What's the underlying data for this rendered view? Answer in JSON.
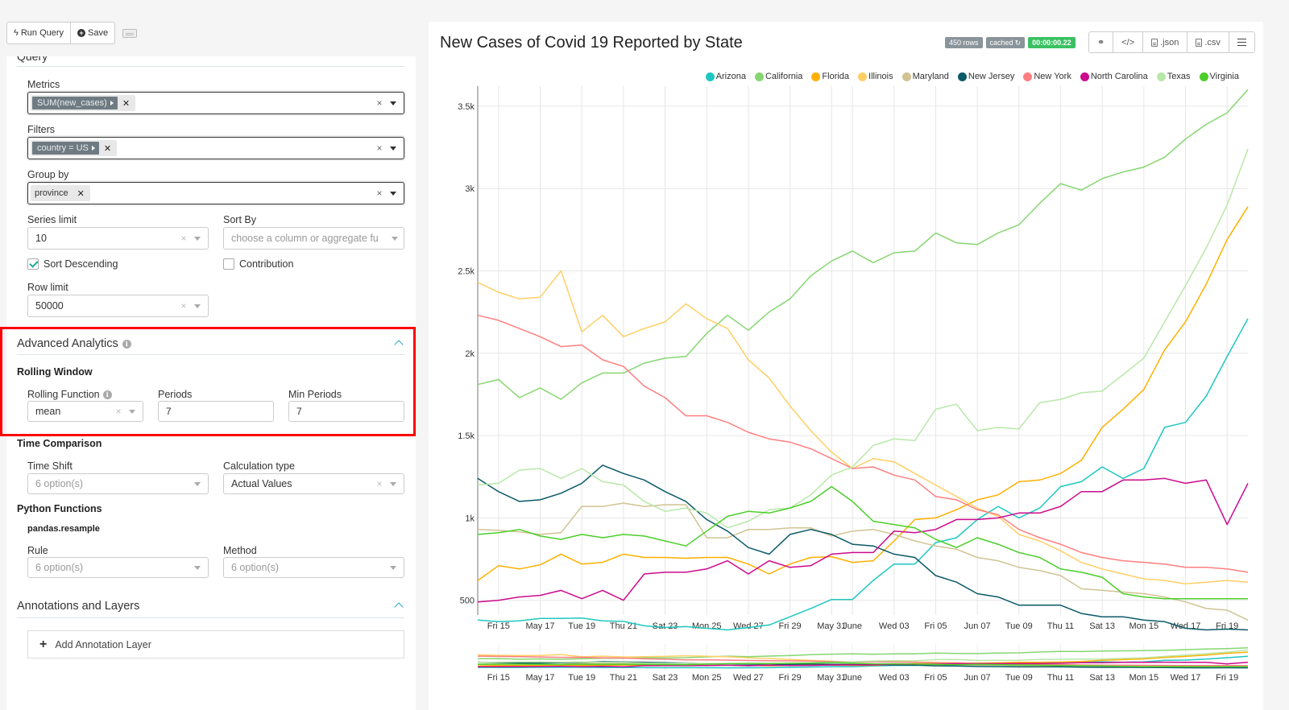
{
  "toolbar": {
    "run_query_label": "Run Query",
    "save_label": "Save"
  },
  "query_section": {
    "title": "Query",
    "metrics": {
      "label": "Metrics",
      "tags": [
        "SUM(new_cases)"
      ]
    },
    "filters": {
      "label": "Filters",
      "tags": [
        "country = US"
      ]
    },
    "group_by": {
      "label": "Group by",
      "tags": [
        "province"
      ]
    },
    "series_limit": {
      "label": "Series limit",
      "value": "10"
    },
    "sort_by": {
      "label": "Sort By",
      "placeholder": "choose a column or aggregate fu"
    },
    "sort_descending": {
      "label": "Sort Descending",
      "checked": true
    },
    "contribution": {
      "label": "Contribution",
      "checked": false
    },
    "row_limit": {
      "label": "Row limit",
      "value": "50000"
    }
  },
  "advanced_analytics": {
    "title": "Advanced Analytics",
    "rolling_window": {
      "heading": "Rolling Window",
      "rolling_function": {
        "label": "Rolling Function",
        "value": "mean"
      },
      "periods": {
        "label": "Periods",
        "value": "7"
      },
      "min_periods": {
        "label": "Min Periods",
        "value": "7"
      }
    },
    "time_comparison": {
      "heading": "Time Comparison",
      "time_shift": {
        "label": "Time Shift",
        "placeholder": "6 option(s)"
      },
      "calculation_type": {
        "label": "Calculation type",
        "value": "Actual Values"
      }
    },
    "python_functions": {
      "heading": "Python Functions",
      "subheading": "pandas.resample",
      "rule": {
        "label": "Rule",
        "placeholder": "6 option(s)"
      },
      "method": {
        "label": "Method",
        "placeholder": "6 option(s)"
      }
    }
  },
  "annotations": {
    "title": "Annotations and Layers",
    "add_label": "Add Annotation Layer"
  },
  "chart_header": {
    "title": "New Cases of Covid 19 Reported by State",
    "rows_badge": "450 rows",
    "cached_badge": "cached",
    "timer_badge": "00:00:00.22",
    "actions": {
      "json": ".json",
      "csv": ".csv"
    }
  },
  "colors": {
    "Arizona": "#1fc7c1",
    "California": "#86d671",
    "Florida": "#ffb000",
    "Illinois": "#ffcf66",
    "Maryland": "#d1c393",
    "New Jersey": "#0b5a68",
    "New York": "#ff7f80",
    "North Carolina": "#cc0a8c",
    "Texas": "#b8e8a8",
    "Virginia": "#4cce2a"
  },
  "chart_data": {
    "type": "line",
    "title": "New Cases of Covid 19 Reported by State",
    "xlabel": "",
    "ylabel": "",
    "ylim": [
      240,
      3600
    ],
    "yticks": [
      500,
      1000,
      1500,
      2000,
      2500,
      3000,
      3500
    ],
    "ytick_labels": [
      "500",
      "1k",
      "1.5k",
      "2k",
      "2.5k",
      "3k",
      "3.5k"
    ],
    "xtick_labels": [
      "Fri 15",
      "May 17",
      "Tue 19",
      "Thu 21",
      "Sat 23",
      "Mon 25",
      "Wed 27",
      "Fri 29",
      "May 31",
      "June",
      "Wed 03",
      "Fri 05",
      "Jun 07",
      "Tue 09",
      "Thu 11",
      "Sat 13",
      "Mon 15",
      "Wed 17",
      "Fri 19"
    ],
    "xtick_day_index": [
      1,
      3,
      5,
      7,
      9,
      11,
      13,
      15,
      17,
      18,
      20,
      22,
      24,
      26,
      28,
      30,
      32,
      34,
      36
    ],
    "x_start": "2020-05-14",
    "x_end": "2020-06-20",
    "grid": true,
    "legend": "top-right",
    "series": [
      {
        "name": "Arizona",
        "values": [
          380,
          370,
          375,
          390,
          390,
          392,
          375,
          372,
          345,
          335,
          340,
          330,
          320,
          335,
          350,
          400,
          450,
          505,
          505,
          620,
          720,
          720,
          850,
          880,
          990,
          1070,
          1000,
          1060,
          1190,
          1220,
          1310,
          1240,
          1300,
          1550,
          1580,
          1740,
          1980,
          2210
        ]
      },
      {
        "name": "California",
        "values": [
          1810,
          1840,
          1730,
          1790,
          1720,
          1820,
          1880,
          1880,
          1940,
          1970,
          1980,
          2120,
          2230,
          2140,
          2250,
          2330,
          2470,
          2560,
          2620,
          2550,
          2610,
          2620,
          2730,
          2670,
          2660,
          2730,
          2780,
          2910,
          3030,
          2990,
          3060,
          3100,
          3130,
          3190,
          3300,
          3390,
          3460,
          3600
        ]
      },
      {
        "name": "Florida",
        "values": [
          620,
          710,
          690,
          715,
          780,
          720,
          730,
          780,
          760,
          760,
          755,
          760,
          760,
          720,
          660,
          720,
          760,
          765,
          730,
          740,
          860,
          990,
          1000,
          1050,
          1110,
          1140,
          1220,
          1230,
          1270,
          1350,
          1550,
          1660,
          1780,
          2020,
          2190,
          2420,
          2690,
          2890
        ]
      },
      {
        "name": "Illinois",
        "values": [
          2430,
          2370,
          2330,
          2340,
          2500,
          2130,
          2230,
          2100,
          2150,
          2190,
          2300,
          2210,
          2150,
          1960,
          1850,
          1680,
          1530,
          1400,
          1300,
          1360,
          1340,
          1270,
          1200,
          1130,
          1060,
          1010,
          900,
          860,
          800,
          730,
          690,
          660,
          630,
          620,
          600,
          610,
          620,
          610
        ]
      },
      {
        "name": "Maryland",
        "values": [
          930,
          925,
          915,
          900,
          910,
          1070,
          1070,
          1090,
          1070,
          1080,
          1080,
          880,
          880,
          930,
          930,
          940,
          940,
          890,
          920,
          930,
          900,
          860,
          830,
          810,
          760,
          740,
          700,
          680,
          650,
          570,
          560,
          550,
          540,
          520,
          490,
          450,
          440,
          380
        ]
      },
      {
        "name": "New Jersey",
        "values": [
          1240,
          1160,
          1100,
          1110,
          1150,
          1210,
          1320,
          1270,
          1230,
          1160,
          1100,
          990,
          920,
          820,
          780,
          900,
          930,
          900,
          840,
          830,
          780,
          760,
          650,
          610,
          540,
          520,
          470,
          470,
          470,
          420,
          400,
          400,
          380,
          370,
          330,
          320,
          325,
          320
        ]
      },
      {
        "name": "New York",
        "values": [
          2230,
          2200,
          2150,
          2100,
          2040,
          2050,
          1960,
          1920,
          1800,
          1730,
          1620,
          1620,
          1580,
          1520,
          1480,
          1460,
          1420,
          1360,
          1300,
          1310,
          1260,
          1230,
          1130,
          1110,
          1050,
          1020,
          930,
          880,
          840,
          790,
          760,
          740,
          730,
          720,
          700,
          700,
          690,
          670
        ]
      },
      {
        "name": "North Carolina",
        "values": [
          490,
          500,
          520,
          530,
          560,
          510,
          560,
          500,
          660,
          670,
          670,
          690,
          740,
          660,
          740,
          700,
          710,
          780,
          790,
          790,
          920,
          910,
          930,
          990,
          990,
          1000,
          1030,
          1030,
          1070,
          1160,
          1160,
          1230,
          1230,
          1240,
          1210,
          1230,
          960,
          1210
        ]
      },
      {
        "name": "Texas",
        "values": [
          1200,
          1210,
          1290,
          1300,
          1240,
          1300,
          1220,
          1200,
          1100,
          1040,
          1060,
          1030,
          940,
          980,
          1050,
          1060,
          1140,
          1260,
          1310,
          1440,
          1480,
          1470,
          1660,
          1690,
          1530,
          1550,
          1540,
          1700,
          1720,
          1760,
          1770,
          1870,
          1970,
          2190,
          2410,
          2640,
          2900,
          3240
        ]
      },
      {
        "name": "Virginia",
        "values": [
          900,
          910,
          930,
          890,
          870,
          900,
          880,
          900,
          890,
          860,
          830,
          920,
          1010,
          1040,
          1030,
          1060,
          1100,
          1190,
          1100,
          980,
          960,
          940,
          870,
          820,
          880,
          840,
          790,
          760,
          690,
          670,
          640,
          540,
          520,
          510,
          510,
          510,
          510,
          510
        ]
      }
    ]
  }
}
